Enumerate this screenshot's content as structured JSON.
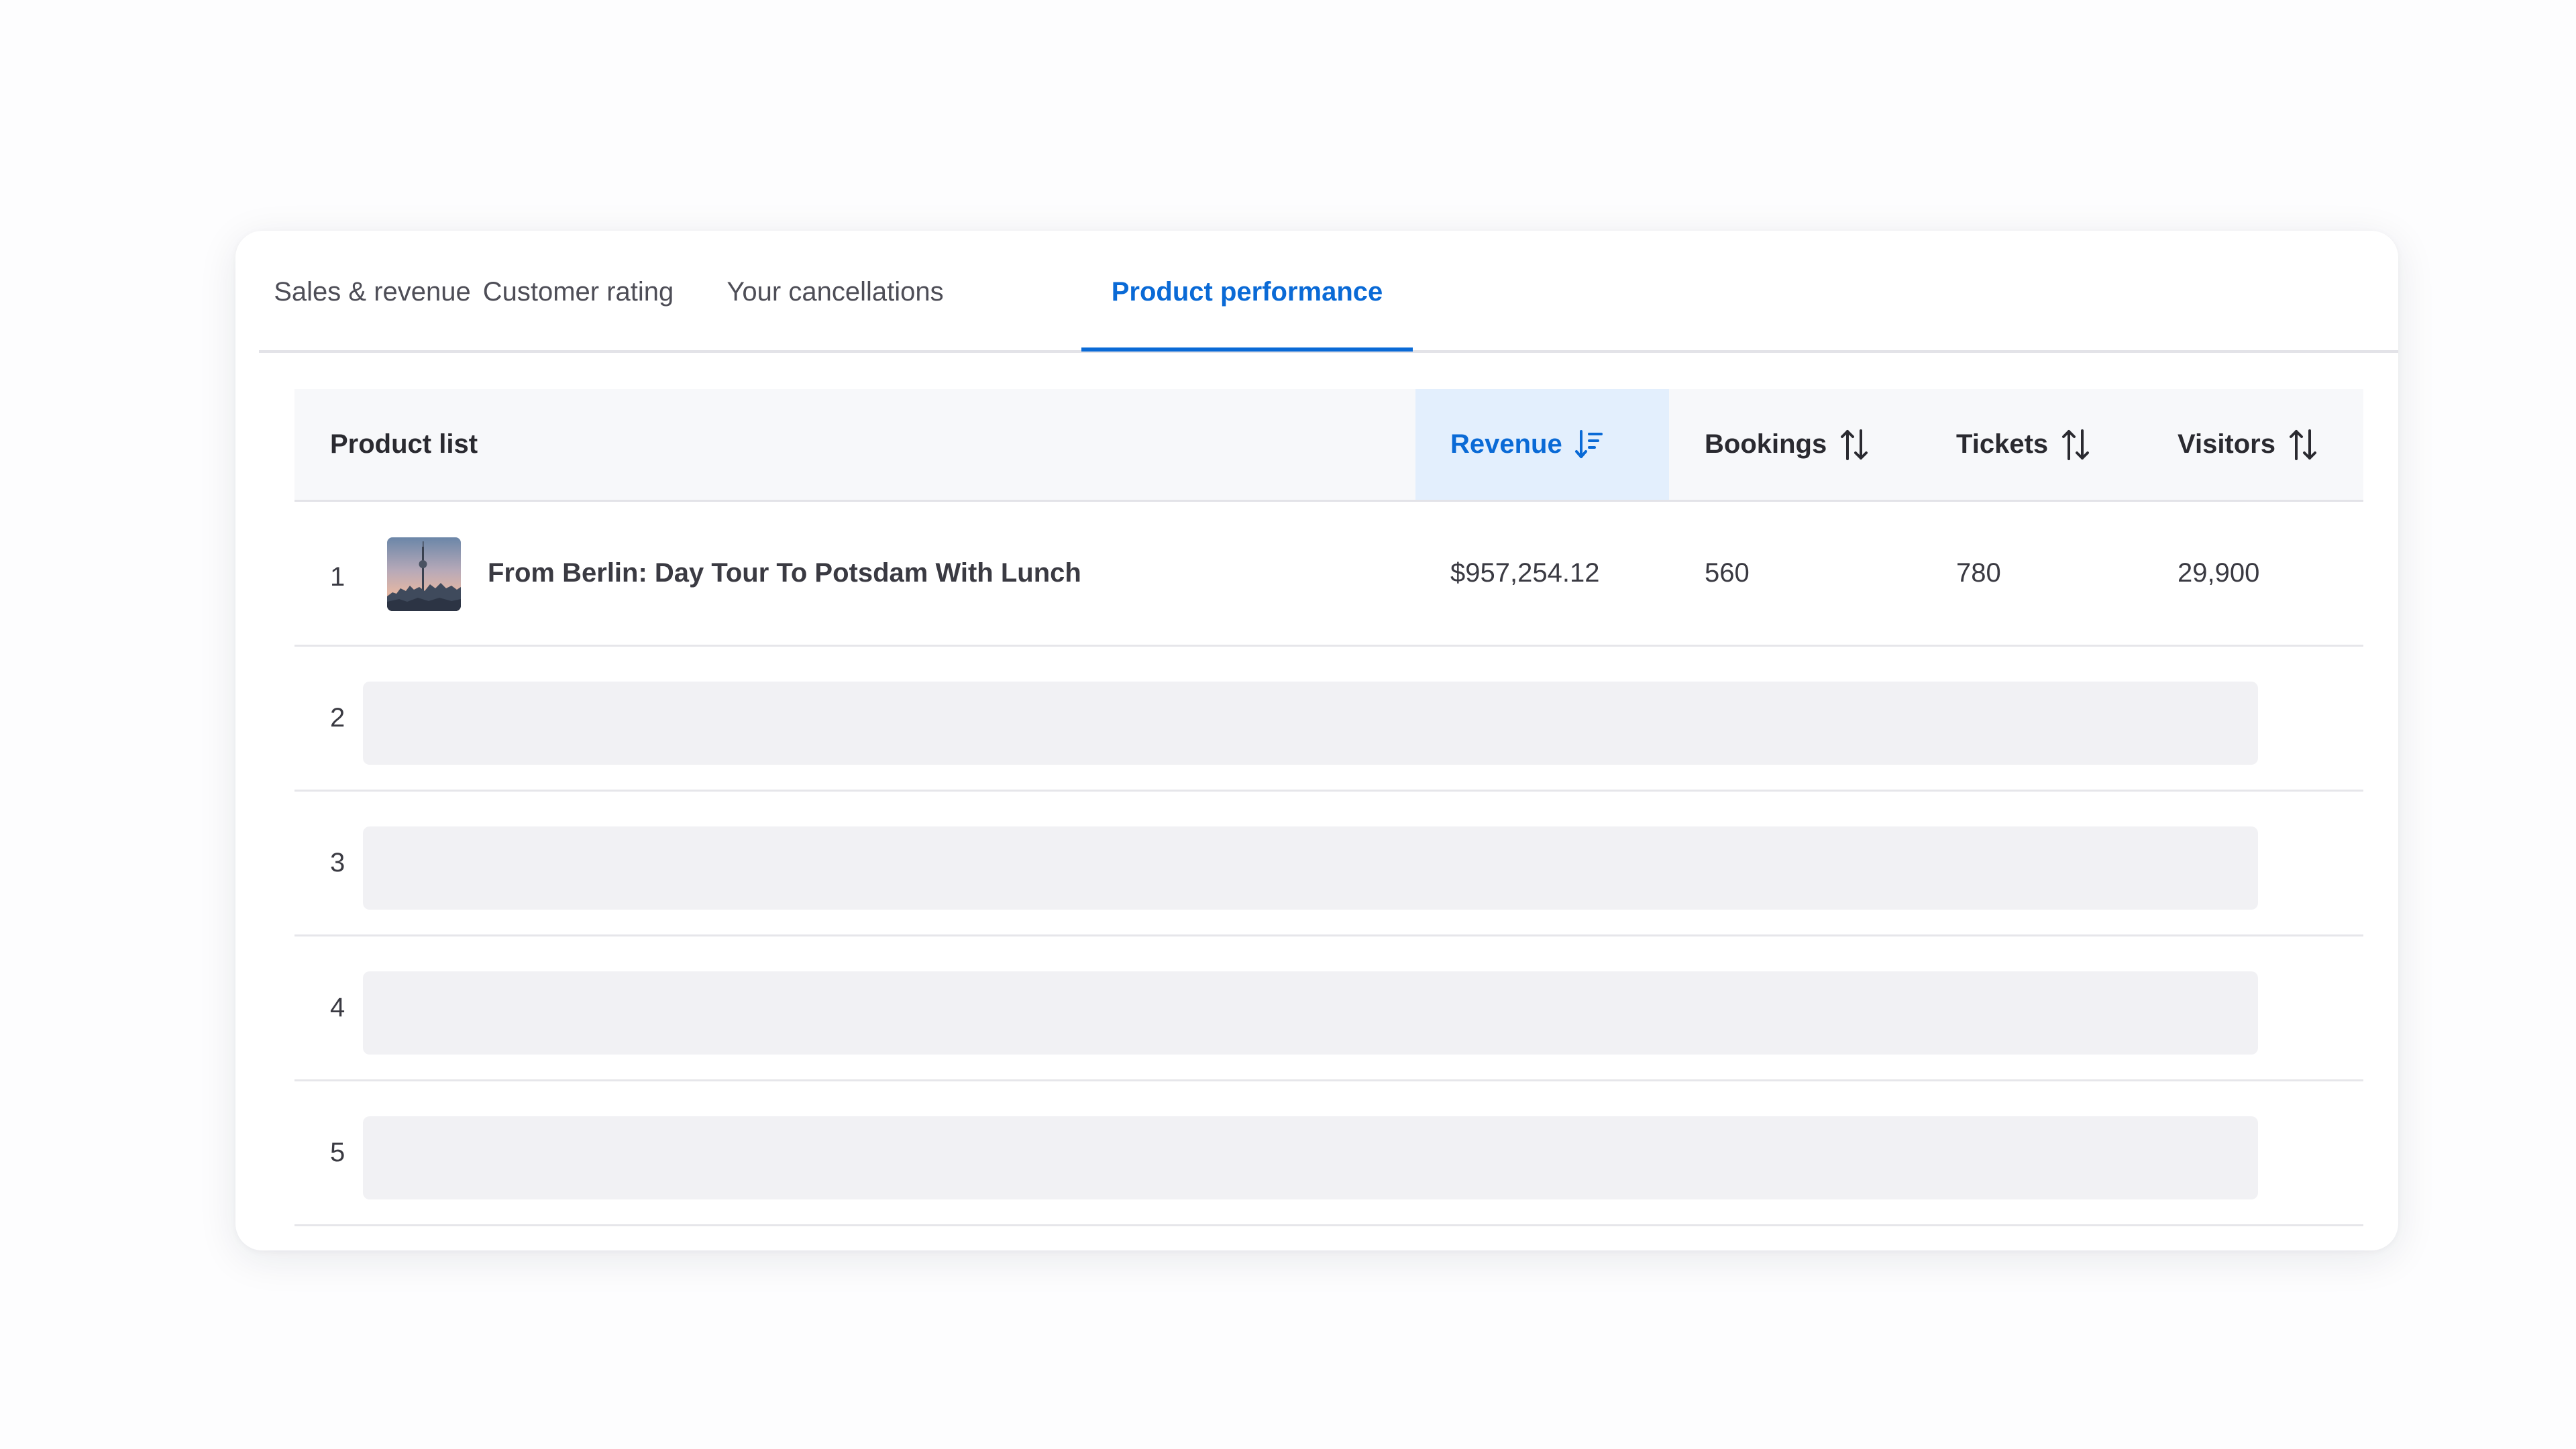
{
  "tabs": [
    {
      "label": "Sales & revenue",
      "active": false
    },
    {
      "label": "Customer rating",
      "active": false
    },
    {
      "label": "Your cancellations",
      "active": false
    },
    {
      "label": "Product performance",
      "active": true
    }
  ],
  "table": {
    "headers": {
      "product": "Product list",
      "revenue": "Revenue",
      "bookings": "Bookings",
      "tickets": "Tickets",
      "visitors": "Visitors"
    },
    "sorted_column": "revenue",
    "rows": [
      {
        "rank": "1",
        "name": "From Berlin: Day Tour To Potsdam With Lunch",
        "revenue": "$957,254.12",
        "bookings": "560",
        "tickets": "780",
        "visitors": "29,900",
        "thumbnail": "berlin-tv-tower-photo"
      },
      {
        "rank": "2",
        "loading": true
      },
      {
        "rank": "3",
        "loading": true
      },
      {
        "rank": "4",
        "loading": true
      },
      {
        "rank": "5",
        "loading": true
      }
    ]
  },
  "colors": {
    "accent": "#0a6ad6",
    "active_column_bg": "#e3effd",
    "header_bg": "#f7f8fa",
    "placeholder": "#f1f1f4",
    "divider": "#e3e3e8"
  },
  "icons": {
    "revenue_sort": "sort-descending-icon",
    "column_sort": "sort-arrows-icon"
  }
}
